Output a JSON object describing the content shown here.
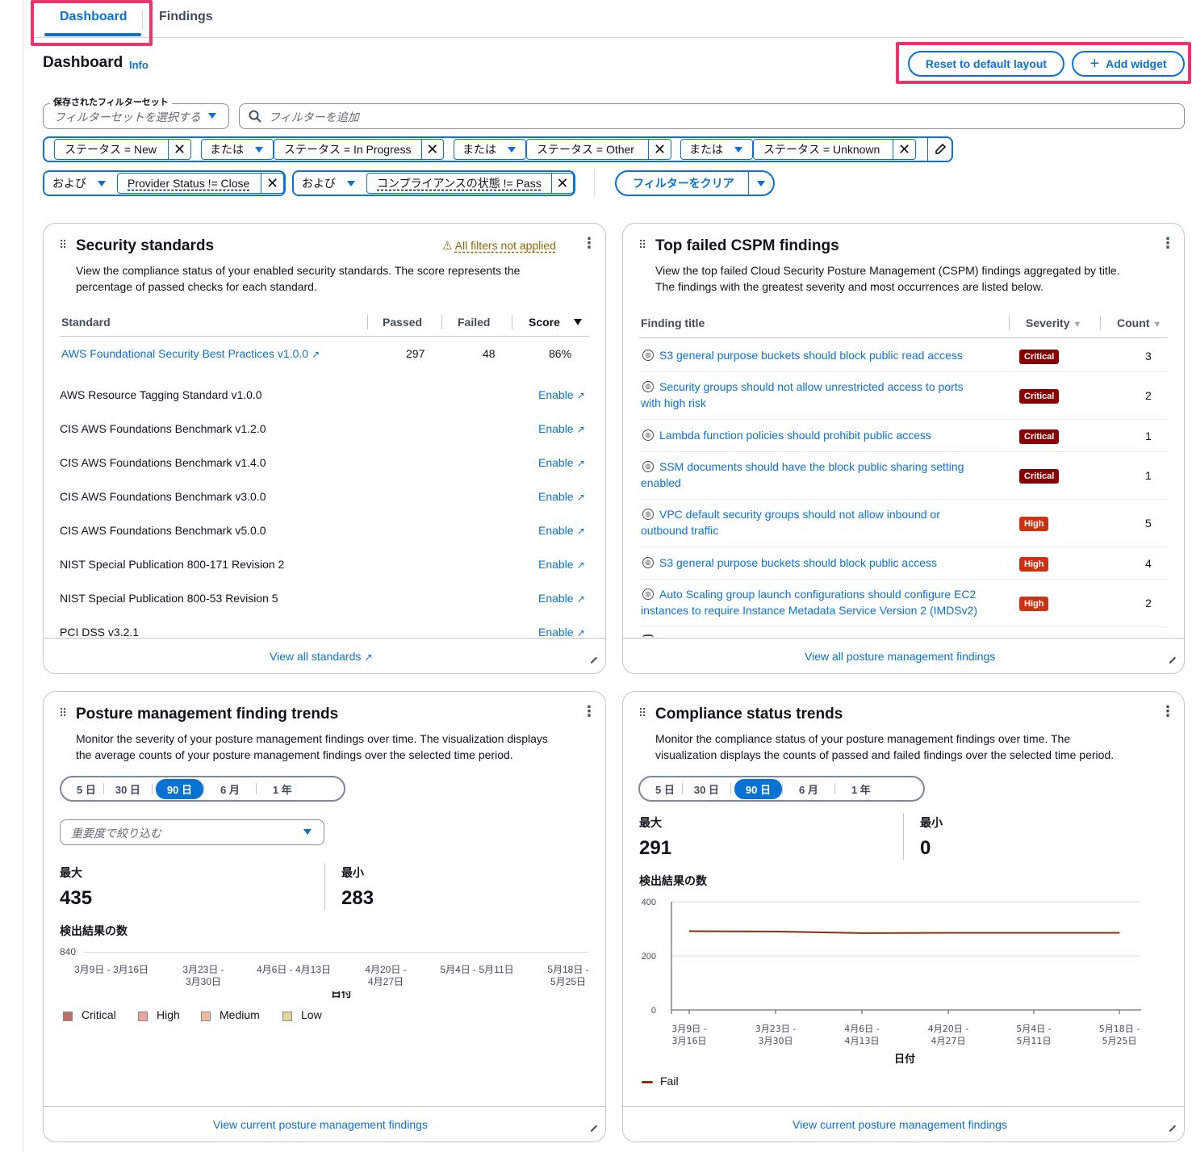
{
  "tabs": {
    "dashboard": "Dashboard",
    "findings": "Findings"
  },
  "header": {
    "title": "Dashboard",
    "info": "Info",
    "reset_btn": "Reset to default layout",
    "add_widget_btn": "Add widget",
    "add_icon": "+"
  },
  "filterset": {
    "legend": "保存されたフィルターセット",
    "placeholder": "フィルターセットを選択する"
  },
  "search": {
    "placeholder": "フィルターを追加"
  },
  "tokens_row1": [
    {
      "label": "ステータス = New"
    },
    {
      "op": "または",
      "label": "ステータス = In Progress"
    },
    {
      "op": "または",
      "label": "ステータス = Other"
    },
    {
      "op": "または",
      "label": "ステータス = Unknown"
    }
  ],
  "tokens_row2": [
    {
      "op": "および",
      "label": "Provider Status != Close"
    },
    {
      "op": "および",
      "label": "コンプライアンスの状態 != Pass"
    }
  ],
  "clear_filters": "フィルターをクリア",
  "security_standards": {
    "title": "Security standards",
    "warning": "All filters not applied",
    "desc1": "View the compliance status of your enabled security standards. The score represents the",
    "desc2": "percentage of passed checks for each standard.",
    "cols": [
      "Standard",
      "Passed",
      "Failed",
      "Score"
    ],
    "enabled_row": {
      "name": "AWS Foundational Security Best Practices v1.0.0",
      "passed": "297",
      "failed": "48",
      "score": "86%"
    },
    "others": [
      "AWS Resource Tagging Standard v1.0.0",
      "CIS AWS Foundations Benchmark v1.2.0",
      "CIS AWS Foundations Benchmark v1.4.0",
      "CIS AWS Foundations Benchmark v3.0.0",
      "CIS AWS Foundations Benchmark v5.0.0",
      "NIST Special Publication 800-171 Revision 2",
      "NIST Special Publication 800-53 Revision 5",
      "PCI DSS v3.2.1"
    ],
    "enable": "Enable",
    "footer": "View all standards"
  },
  "cspm": {
    "title": "Top failed CSPM findings",
    "desc1": "View the top failed Cloud Security Posture Management (CSPM) findings aggregated by title.",
    "desc2": "The findings with the greatest severity and most occurrences are listed below.",
    "cols": [
      "Finding title",
      "Severity",
      "Count"
    ],
    "rows": [
      {
        "l1": "S3 general purpose buckets should block public read access",
        "l2": "",
        "sev": "Critical",
        "count": "3"
      },
      {
        "l1": "Security groups should not allow unrestricted access to ports",
        "l2": "with high risk",
        "sev": "Critical",
        "count": "2"
      },
      {
        "l1": "Lambda function policies should prohibit public access",
        "l2": "",
        "sev": "Critical",
        "count": "1"
      },
      {
        "l1": "SSM documents should have the block public sharing setting",
        "l2": "enabled",
        "sev": "Critical",
        "count": "1"
      },
      {
        "l1": "VPC default security groups should not allow inbound or",
        "l2": "outbound traffic",
        "sev": "High",
        "count": "5"
      },
      {
        "l1": "S3 general purpose buckets should block public access",
        "l2": "",
        "sev": "High",
        "count": "4"
      },
      {
        "l1": "Auto Scaling group launch configurations should configure EC2",
        "l2": "instances to require Instance Metadata Service Version 2 (IMDSv2)",
        "sev": "High",
        "count": "2"
      }
    ],
    "footer": "View all posture management findings"
  },
  "posture_trends": {
    "title": "Posture management finding trends",
    "desc1": "Monitor the severity of your posture management findings over time. The visualization displays",
    "desc2": "the average counts of your posture management findings over the selected time period.",
    "ranges": [
      "5 日",
      "30 日",
      "90 日",
      "6 月",
      "1 年"
    ],
    "selected_range": "90 日",
    "severity_filter": "重要度で絞り込む",
    "max_label": "最大",
    "max_value": "435",
    "min_label": "最小",
    "min_value": "283",
    "chart_title": "検出結果の数",
    "y_top": "840",
    "x_ticks": [
      "3月9日 - 3月16日",
      "3月23日 -|3月30日",
      "4月6日 - 4月13日",
      "4月20日 -|4月27日",
      "5月4日 - 5月11日",
      "5月18日 -|5月25日"
    ],
    "legend": [
      "Critical",
      "High",
      "Medium",
      "Low"
    ],
    "legend_colors": [
      "#c26b6b",
      "#e8a59a",
      "#f0b9a0",
      "#e8d49a"
    ],
    "footer": "View current posture management findings"
  },
  "compliance_trends": {
    "title": "Compliance status trends",
    "desc1": "Monitor the compliance status of your posture management findings over time. The",
    "desc2": "visualization displays the counts of passed and failed findings over the selected time period.",
    "ranges": [
      "5 日",
      "30 日",
      "90 日",
      "6 月",
      "1 年"
    ],
    "selected_range": "90 日",
    "max_label": "最大",
    "max_value": "291",
    "min_label": "最小",
    "min_value": "0",
    "chart_title": "検出結果の数",
    "xlabel": "日付",
    "legend": "Fail",
    "footer": "View current posture management findings"
  },
  "chart_data": {
    "type": "line",
    "title": "検出結果の数",
    "xlabel": "日付",
    "ylabel": "",
    "ylim": [
      0,
      400
    ],
    "yticks": [
      0,
      200,
      400
    ],
    "categories": [
      "3月9日 - 3月16日",
      "3月23日 - 3月30日",
      "4月6日 - 4月13日",
      "4月20日 - 4月27日",
      "5月4日 - 5月11日",
      "5月18日 - 5月25日"
    ],
    "series": [
      {
        "name": "Fail",
        "color": "#8b2d0f",
        "values": [
          291,
          290,
          284,
          285,
          285,
          285
        ]
      }
    ],
    "grid": true,
    "legend_position": "bottom-left"
  }
}
